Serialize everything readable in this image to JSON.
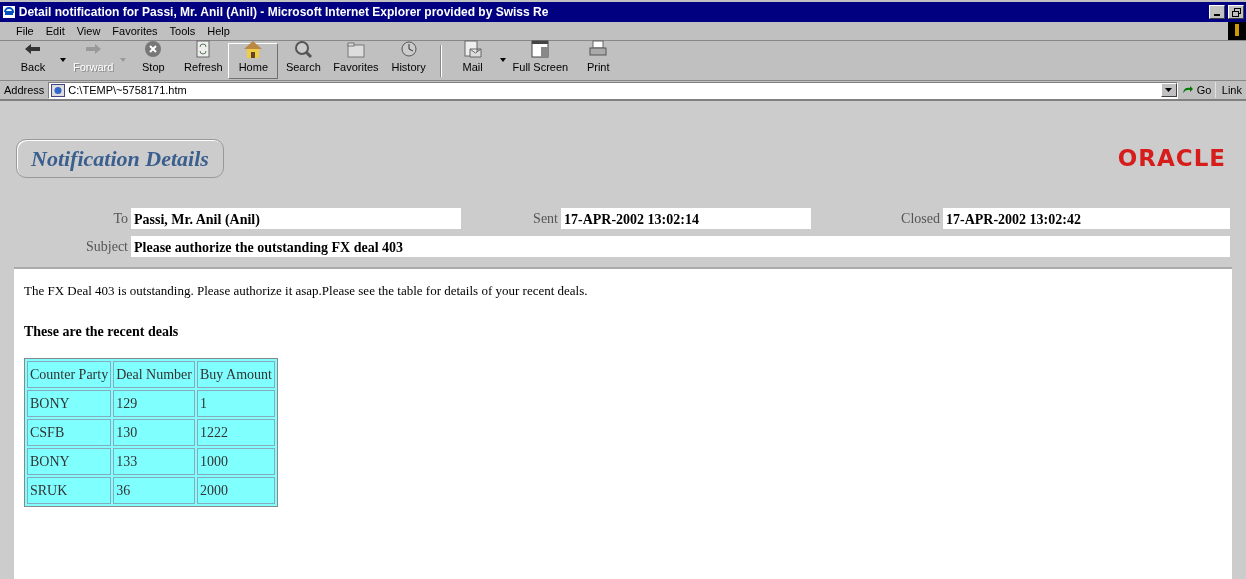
{
  "window": {
    "title": "Detail notification for Passi, Mr. Anil (Anil) - Microsoft Internet Explorer provided by Swiss Re"
  },
  "menu": [
    {
      "label": "File"
    },
    {
      "label": "Edit"
    },
    {
      "label": "View"
    },
    {
      "label": "Favorites"
    },
    {
      "label": "Tools"
    },
    {
      "label": "Help"
    }
  ],
  "toolbar": [
    {
      "label": "Back",
      "kind": "back",
      "disabled": false,
      "pressed": false,
      "dropdown": true
    },
    {
      "label": "Forward",
      "kind": "forward",
      "disabled": true,
      "pressed": false,
      "dropdown": true
    },
    {
      "label": "Stop",
      "kind": "stop",
      "disabled": false,
      "pressed": false,
      "dropdown": false
    },
    {
      "label": "Refresh",
      "kind": "refresh",
      "disabled": false,
      "pressed": false,
      "dropdown": false
    },
    {
      "label": "Home",
      "kind": "home",
      "disabled": false,
      "pressed": true,
      "dropdown": false
    },
    {
      "label": "Search",
      "kind": "search",
      "disabled": false,
      "pressed": false,
      "dropdown": false
    },
    {
      "label": "Favorites",
      "kind": "favorites",
      "disabled": false,
      "pressed": false,
      "dropdown": false
    },
    {
      "label": "History",
      "kind": "history",
      "disabled": false,
      "pressed": false,
      "dropdown": false
    },
    {
      "label": "Mail",
      "kind": "mail",
      "disabled": false,
      "pressed": false,
      "dropdown": true
    },
    {
      "label": "Full Screen",
      "kind": "fullscreen",
      "disabled": false,
      "pressed": false,
      "dropdown": false
    },
    {
      "label": "Print",
      "kind": "print",
      "disabled": false,
      "pressed": false,
      "dropdown": false
    }
  ],
  "address": {
    "label": "Address",
    "value": "C:\\TEMP\\~5758171.htm",
    "go": "Go",
    "links": "Link"
  },
  "page": {
    "heading": "Notification Details",
    "logo": "ORACLE",
    "fields": [
      {
        "label": "To",
        "value": "Passi, Mr. Anil (Anil)"
      },
      {
        "label": "Sent",
        "value": "17-APR-2002 13:02:14"
      },
      {
        "label": "Closed",
        "value": "17-APR-2002 13:02:42"
      }
    ],
    "subject": {
      "label": "Subject",
      "value": "Please authorize the outstanding FX deal 403"
    },
    "message": "The FX Deal 403 is outstanding. Please authorize it asap.Please see the table for details of your recent deals.",
    "table_title": "These are the recent deals",
    "table": {
      "columns": [
        "Counter Party",
        "Deal Number",
        "Buy Amount"
      ],
      "rows": [
        [
          "BONY",
          "129",
          "1"
        ],
        [
          "CSFB",
          "130",
          "1222"
        ],
        [
          "BONY",
          "133",
          "1000"
        ],
        [
          "SRUK",
          "36",
          "2000"
        ]
      ]
    }
  }
}
